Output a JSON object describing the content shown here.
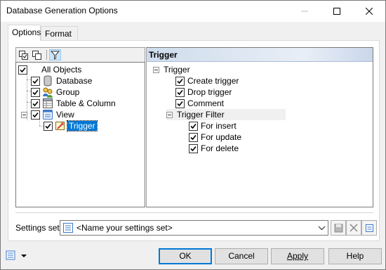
{
  "window": {
    "title": "Database Generation Options"
  },
  "tabs": [
    {
      "label": "Options",
      "active": true
    },
    {
      "label": "Format",
      "active": false
    }
  ],
  "tree": {
    "items": [
      {
        "label": "All Objects",
        "checked": true
      },
      {
        "label": "Database",
        "checked": true,
        "icon": "database-icon"
      },
      {
        "label": "Group",
        "checked": true,
        "icon": "group-icon"
      },
      {
        "label": "Table & Column",
        "checked": true,
        "icon": "table-icon"
      },
      {
        "label": "View",
        "checked": true,
        "icon": "view-icon"
      },
      {
        "label": "Trigger",
        "checked": true,
        "icon": "trigger-icon",
        "selected": true
      }
    ]
  },
  "panel": {
    "header": "Trigger",
    "group_label": "Trigger",
    "options": [
      {
        "label": "Create trigger",
        "checked": true
      },
      {
        "label": "Drop trigger",
        "checked": true
      },
      {
        "label": "Comment",
        "checked": true
      }
    ],
    "filter_label": "Trigger Filter",
    "filter_options": [
      {
        "label": "For insert",
        "checked": true
      },
      {
        "label": "For update",
        "checked": true
      },
      {
        "label": "For delete",
        "checked": true
      }
    ]
  },
  "settings": {
    "label": "Settings set:",
    "value": "<Name your settings set>"
  },
  "buttons": {
    "ok": "OK",
    "cancel": "Cancel",
    "apply": "Apply",
    "help": "Help"
  },
  "colors": {
    "accent": "#0078d7",
    "header_gradient": "#cfdcec"
  }
}
